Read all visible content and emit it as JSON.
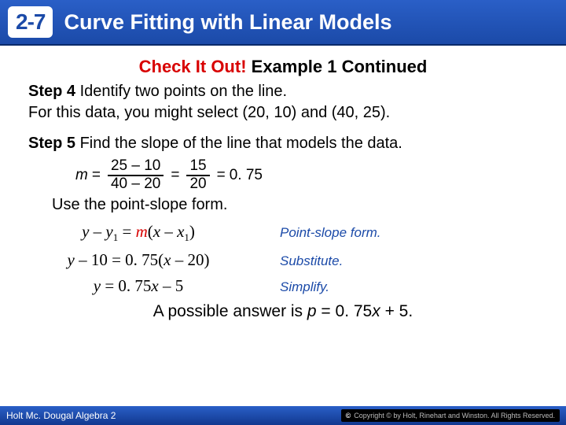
{
  "header": {
    "section_number": "2-7",
    "title": "Curve Fitting with Linear Models"
  },
  "subtitle": {
    "red": "Check It Out!",
    "black": " Example 1 Continued"
  },
  "step4": {
    "label": "Step 4",
    "text1": " Identify two points on the line.",
    "text2": "For this data, you might select (20, 10) and (40, 25)."
  },
  "step5": {
    "label": "Step 5",
    "text": " Find the slope of the line that models the data."
  },
  "slope_calc": {
    "m": "m",
    "num1": "25 – 10",
    "den1": "40 – 20",
    "num2": "15",
    "den2": "20",
    "result": "0. 75"
  },
  "use_line": "Use the point-slope form.",
  "equations": [
    {
      "left_html": "y – y<sub>1</sub> = m(x – x<sub>1</sub>)",
      "right": "Point-slope form."
    },
    {
      "left_html": "y – 10 = 0. 75(x – 20)",
      "right": "Substitute."
    },
    {
      "left_html": "y = 0. 75x – 5",
      "right": "Simplify."
    }
  ],
  "final": {
    "pre": "A possible answer is ",
    "eq": "p = 0. 75x + 5."
  },
  "footer": {
    "book": "Holt Mc. Dougal Algebra 2",
    "copyright": "Copyright © by Holt, Rinehart and Winston. All Rights Reserved."
  }
}
